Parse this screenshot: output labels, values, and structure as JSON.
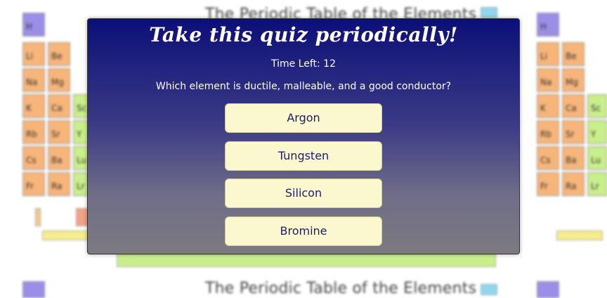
{
  "background": {
    "table_title": "The Periodic Table of the Elements",
    "left_column_elements": [
      "H",
      "Li",
      "Na",
      "K",
      "Rb",
      "Cs",
      "Fr"
    ],
    "second_column_elements": [
      "Be",
      "Mg",
      "Ca",
      "Sr",
      "Ba",
      "Ra"
    ],
    "third_column_elements": [
      "Sc",
      "Y",
      "Lu",
      "Lr"
    ]
  },
  "quiz": {
    "title": "Take this quiz periodically!",
    "timer_text": "Time Left: 12",
    "question": "Which element is ductile, malleable, and a good conductor?",
    "answers": [
      "Argon",
      "Tungsten",
      "Silicon",
      "Bromine"
    ]
  },
  "colors": {
    "modal_top": "#0c0f78",
    "modal_bottom": "#7c7a80",
    "answer_bg": "#fbf8d0",
    "answer_text": "#1e1a6e",
    "alkali": "#f7b57a",
    "hydrogen": "#9a8ee8",
    "transition": "#c9ef8a"
  }
}
